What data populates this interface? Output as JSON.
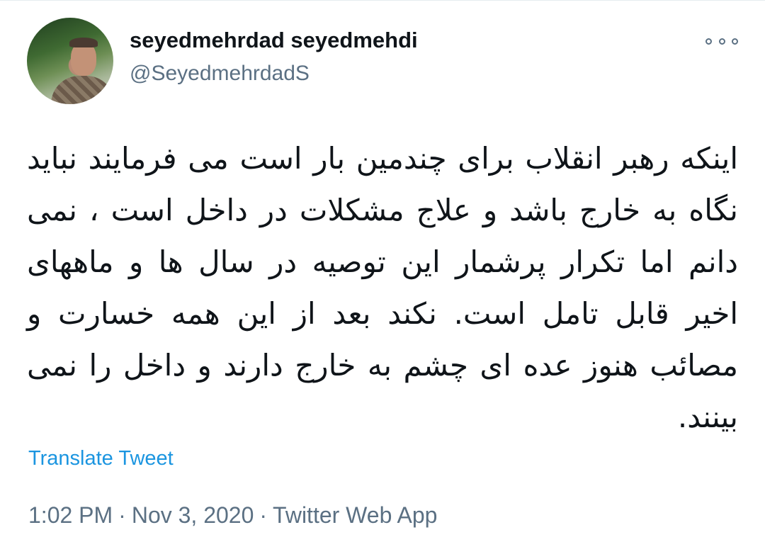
{
  "tweet": {
    "author": {
      "display_name": "seyedmehrdad seyedmehdi",
      "handle": "@SeyedmehrdadS"
    },
    "more_icon": "more-horizontal-icon",
    "text": "اینکه رهبر انقلاب برای چندمین بار است می فرمایند نباید نگاه به خارج باشد و علاج مشکلات در داخل است ، نمی دانم اما تکرار پرشمار این توصیه در سال ها و ماههای اخیر قابل تامل است. نکند بعد از این همه خسارت و مصائب هنوز عده ای چشم به خارج دارند و داخل را نمی بینند.",
    "translate_label": "Translate Tweet",
    "time": "1:02 PM",
    "date": "Nov 3, 2020",
    "separator": "·",
    "source": "Twitter Web App"
  },
  "colors": {
    "text_primary": "#0f1419",
    "text_secondary": "#5b7083",
    "link": "#1b95e0"
  }
}
